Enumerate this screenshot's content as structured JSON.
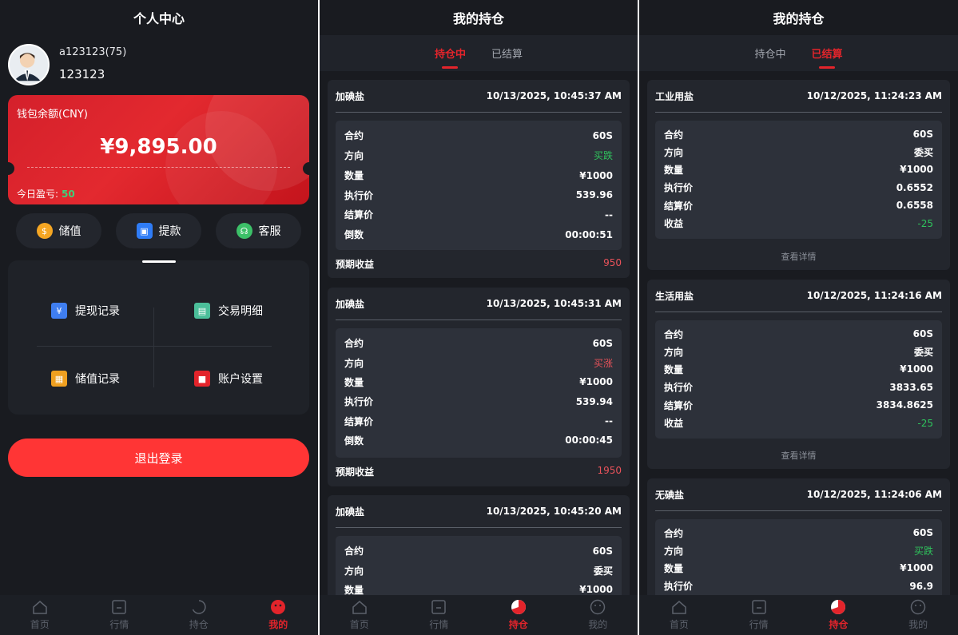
{
  "screen1": {
    "title": "个人中心",
    "user": {
      "name": "a123123(75)",
      "id": "123123"
    },
    "wallet": {
      "label": "钱包余额(CNY)",
      "amount": "¥9,895.00",
      "pnl_label": "今日盈亏:",
      "pnl_value": "50"
    },
    "quick": [
      {
        "label": "储值",
        "icon": "coin-icon",
        "color": "#f5a623"
      },
      {
        "label": "提款",
        "icon": "wallet-icon",
        "color": "#2f7cf6"
      },
      {
        "label": "客服",
        "icon": "support-icon",
        "color": "#3cc068"
      }
    ],
    "menu": [
      {
        "label": "提现记录",
        "icon": "yuan-card-icon",
        "color": "#3f7ef0"
      },
      {
        "label": "交易明细",
        "icon": "ledger-icon",
        "color": "#4bbf9a"
      },
      {
        "label": "储值记录",
        "icon": "receipt-icon",
        "color": "#f0a020"
      },
      {
        "label": "账户设置",
        "icon": "lock-icon",
        "color": "#e3242b"
      }
    ],
    "logout": "退出登录"
  },
  "nav": [
    "首页",
    "行情",
    "持仓",
    "我的"
  ],
  "screen2": {
    "title": "我的持仓",
    "tabs": [
      "持仓中",
      "已结算"
    ],
    "labels": {
      "contract": "合约",
      "direction": "方向",
      "qty": "数量",
      "exec": "执行价",
      "settle": "结算价",
      "countdown": "倒数",
      "expected": "预期收益"
    },
    "cards": [
      {
        "name": "加碘盐",
        "time": "10/13/2025, 10:45:37 AM",
        "contract": "60S",
        "direction": "买跌",
        "qty": "¥1000",
        "exec": "539.96",
        "settle": "--",
        "countdown": "00:00:51",
        "expected": "950"
      },
      {
        "name": "加碘盐",
        "time": "10/13/2025, 10:45:31 AM",
        "contract": "60S",
        "direction": "买涨",
        "qty": "¥1000",
        "exec": "539.94",
        "settle": "--",
        "countdown": "00:00:45",
        "expected": "1950"
      },
      {
        "name": "加碘盐",
        "time": "10/13/2025, 10:45:20 AM",
        "contract": "60S",
        "direction": "委买",
        "qty": "¥1000"
      }
    ]
  },
  "screen3": {
    "title": "我的持仓",
    "tabs": [
      "持仓中",
      "已结算"
    ],
    "labels": {
      "contract": "合约",
      "direction": "方向",
      "qty": "数量",
      "exec": "执行价",
      "settle": "结算价",
      "profit": "收益",
      "detail": "查看详情"
    },
    "cards": [
      {
        "name": "工业用盐",
        "time": "10/12/2025, 11:24:23 AM",
        "contract": "60S",
        "direction": "委买",
        "qty": "¥1000",
        "exec": "0.6552",
        "settle": "0.6558",
        "profit": "-25"
      },
      {
        "name": "生活用盐",
        "time": "10/12/2025, 11:24:16 AM",
        "contract": "60S",
        "direction": "委买",
        "qty": "¥1000",
        "exec": "3833.65",
        "settle": "3834.8625",
        "profit": "-25"
      },
      {
        "name": "无碘盐",
        "time": "10/12/2025, 11:24:06 AM",
        "contract": "60S",
        "direction": "买跌",
        "qty": "¥1000",
        "exec": "96.9"
      }
    ]
  }
}
